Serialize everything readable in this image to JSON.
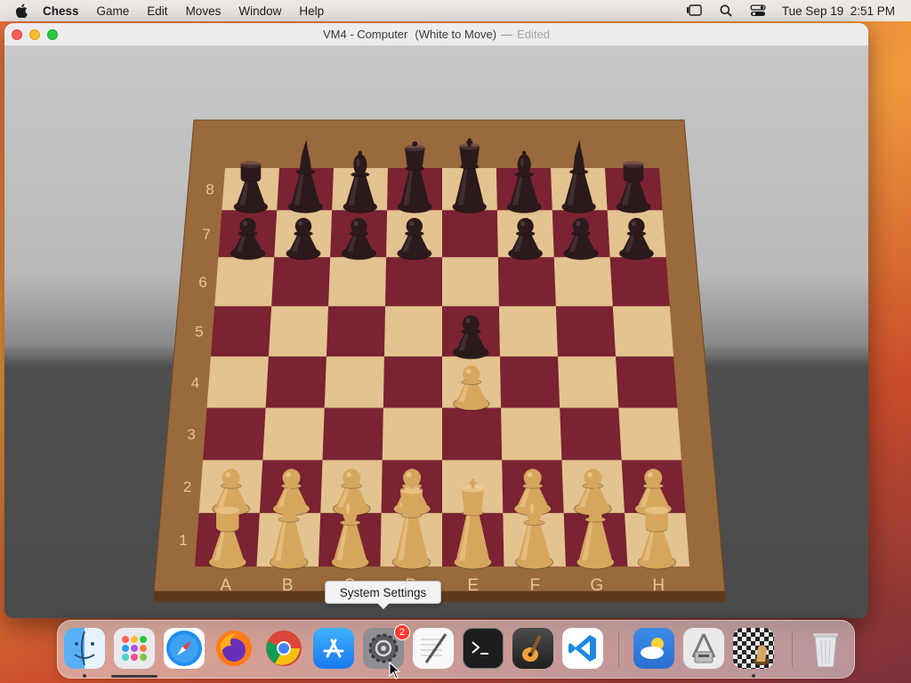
{
  "menubar": {
    "app_name": "Chess",
    "menus": [
      "Game",
      "Edit",
      "Moves",
      "Window",
      "Help"
    ],
    "datetime": "Tue Sep 19  2:51 PM"
  },
  "window": {
    "title": "VM4 - Computer",
    "status": "(White to Move)",
    "separator": "—",
    "edited": "Edited"
  },
  "board": {
    "ranks": [
      "8",
      "7",
      "6",
      "5",
      "4",
      "3",
      "2",
      "1"
    ],
    "files": [
      "A",
      "B",
      "C",
      "D",
      "E",
      "F",
      "G",
      "H"
    ],
    "light_square": "#e3c38f",
    "dark_square": "#7b2233",
    "frame_color": "#9a6a3c",
    "pieces": [
      {
        "square": "a8",
        "piece": "rook",
        "color": "black"
      },
      {
        "square": "b8",
        "piece": "knight",
        "color": "black"
      },
      {
        "square": "c8",
        "piece": "bishop",
        "color": "black"
      },
      {
        "square": "d8",
        "piece": "queen",
        "color": "black"
      },
      {
        "square": "e8",
        "piece": "king",
        "color": "black"
      },
      {
        "square": "f8",
        "piece": "bishop",
        "color": "black"
      },
      {
        "square": "g8",
        "piece": "knight",
        "color": "black"
      },
      {
        "square": "h8",
        "piece": "rook",
        "color": "black"
      },
      {
        "square": "a7",
        "piece": "pawn",
        "color": "black"
      },
      {
        "square": "b7",
        "piece": "pawn",
        "color": "black"
      },
      {
        "square": "c7",
        "piece": "pawn",
        "color": "black"
      },
      {
        "square": "d7",
        "piece": "pawn",
        "color": "black"
      },
      {
        "square": "f7",
        "piece": "pawn",
        "color": "black"
      },
      {
        "square": "g7",
        "piece": "pawn",
        "color": "black"
      },
      {
        "square": "h7",
        "piece": "pawn",
        "color": "black"
      },
      {
        "square": "e5",
        "piece": "pawn",
        "color": "black"
      },
      {
        "square": "e4",
        "piece": "pawn",
        "color": "white"
      },
      {
        "square": "a2",
        "piece": "pawn",
        "color": "white"
      },
      {
        "square": "b2",
        "piece": "pawn",
        "color": "white"
      },
      {
        "square": "c2",
        "piece": "pawn",
        "color": "white"
      },
      {
        "square": "d2",
        "piece": "pawn",
        "color": "white"
      },
      {
        "square": "f2",
        "piece": "pawn",
        "color": "white"
      },
      {
        "square": "g2",
        "piece": "pawn",
        "color": "white"
      },
      {
        "square": "h2",
        "piece": "pawn",
        "color": "white"
      },
      {
        "square": "a1",
        "piece": "rook",
        "color": "white"
      },
      {
        "square": "b1",
        "piece": "knight",
        "color": "white"
      },
      {
        "square": "c1",
        "piece": "bishop",
        "color": "white"
      },
      {
        "square": "d1",
        "piece": "queen",
        "color": "white"
      },
      {
        "square": "e1",
        "piece": "king",
        "color": "white"
      },
      {
        "square": "f1",
        "piece": "bishop",
        "color": "white"
      },
      {
        "square": "g1",
        "piece": "knight",
        "color": "white"
      },
      {
        "square": "h1",
        "piece": "rook",
        "color": "white"
      }
    ]
  },
  "tooltip": {
    "text": "System Settings"
  },
  "dock": {
    "items": [
      {
        "name": "finder-icon",
        "running": true
      },
      {
        "name": "launchpad-icon",
        "running": false
      },
      {
        "name": "safari-icon",
        "running": false
      },
      {
        "name": "firefox-icon",
        "running": false
      },
      {
        "name": "chrome-icon",
        "running": false
      },
      {
        "name": "app-store-icon",
        "running": false
      },
      {
        "name": "system-settings-icon",
        "running": false,
        "badge": "2"
      },
      {
        "name": "textedit-icon",
        "running": false
      },
      {
        "name": "terminal-icon",
        "running": false
      },
      {
        "name": "garageband-icon",
        "running": false
      },
      {
        "name": "vscode-icon",
        "running": false
      },
      {
        "name": "weather-icon",
        "running": false
      },
      {
        "name": "archive-utility-icon",
        "running": false
      },
      {
        "name": "chess-icon",
        "running": true
      },
      {
        "name": "trash-icon",
        "running": false
      }
    ]
  }
}
